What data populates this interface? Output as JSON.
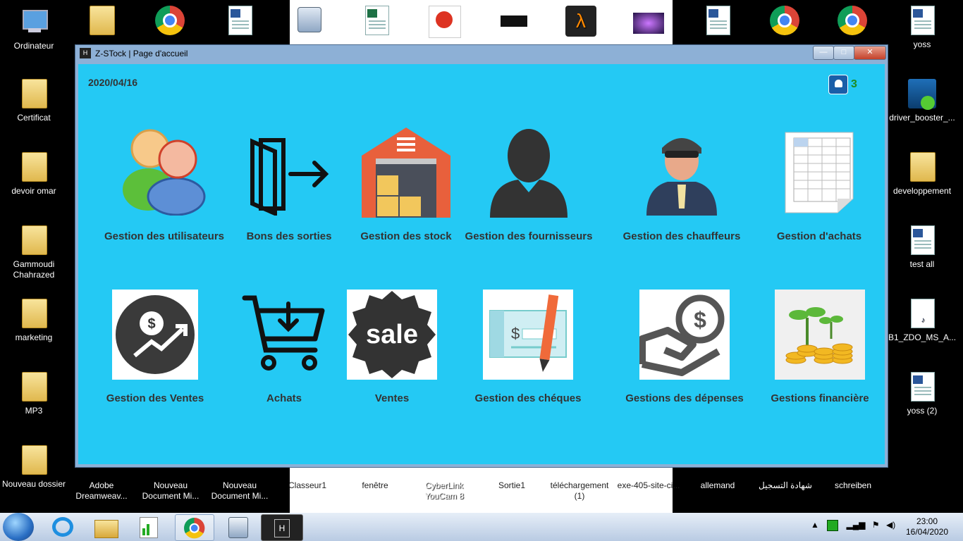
{
  "desktop": {
    "left_icons": [
      {
        "label": "Ordinateur"
      },
      {
        "label": "Certificat"
      },
      {
        "label": "devoir omar"
      },
      {
        "label": "Gammoudi Chahrazed"
      },
      {
        "label": "marketing"
      },
      {
        "label": "MP3"
      },
      {
        "label": "Nouveau dossier"
      }
    ],
    "right_icons": [
      {
        "label": "yoss"
      },
      {
        "label": "driver_booster_..."
      },
      {
        "label": "developpement"
      },
      {
        "label": "test all"
      },
      {
        "label": "B1_ZDO_MS_A..."
      },
      {
        "label": "yoss (2)"
      }
    ],
    "bottom_icons": [
      {
        "label": "Adobe Dreamweav..."
      },
      {
        "label": "Nouveau Document Mi..."
      },
      {
        "label": "Nouveau Document Mi..."
      },
      {
        "label": "Classeur1"
      },
      {
        "label": "fenêtre"
      },
      {
        "label": "CyberLink YouCam 8"
      },
      {
        "label": "Sortie1"
      },
      {
        "label": "téléchargement (1)"
      },
      {
        "label": "exe-405-site-ci..."
      },
      {
        "label": "allemand"
      },
      {
        "label": "شهادة التسجيل"
      },
      {
        "label": "schreiben"
      }
    ]
  },
  "window": {
    "app_icon_letter": "H",
    "title": "Z-STock | Page d'accueil",
    "min_glyph": "—",
    "max_glyph": "□",
    "close_glyph": "✕",
    "date": "2020/04/16",
    "notification_count": "3"
  },
  "tiles": [
    {
      "label": "Gestion des utilisateurs",
      "icon": "users-icon"
    },
    {
      "label": "Bons des sorties",
      "icon": "exit-door-icon"
    },
    {
      "label": "Gestion des stock",
      "icon": "warehouse-icon"
    },
    {
      "label": "Gestion des fournisseurs",
      "icon": "supplier-person-icon"
    },
    {
      "label": "Gestion des chauffeurs",
      "icon": "driver-icon"
    },
    {
      "label": "Gestion d'achats",
      "icon": "spreadsheet-icon"
    },
    {
      "label": "Gestion des Ventes",
      "icon": "sales-growth-icon"
    },
    {
      "label": "Achats",
      "icon": "cart-download-icon"
    },
    {
      "label": "Ventes",
      "icon": "sale-badge-icon"
    },
    {
      "label": "Gestion des chéques",
      "icon": "cheque-icon"
    },
    {
      "label": "Gestions des dépenses",
      "icon": "hand-coin-icon"
    },
    {
      "label": "Gestions financière",
      "icon": "coins-plant-icon"
    }
  ],
  "sale_text": "sale",
  "taskbar": {
    "clock_time": "23:00",
    "clock_date": "16/04/2020"
  },
  "colors": {
    "client_bg": "#24c9f4",
    "label_text": "#333333",
    "notification_count": "#1e8b22"
  }
}
